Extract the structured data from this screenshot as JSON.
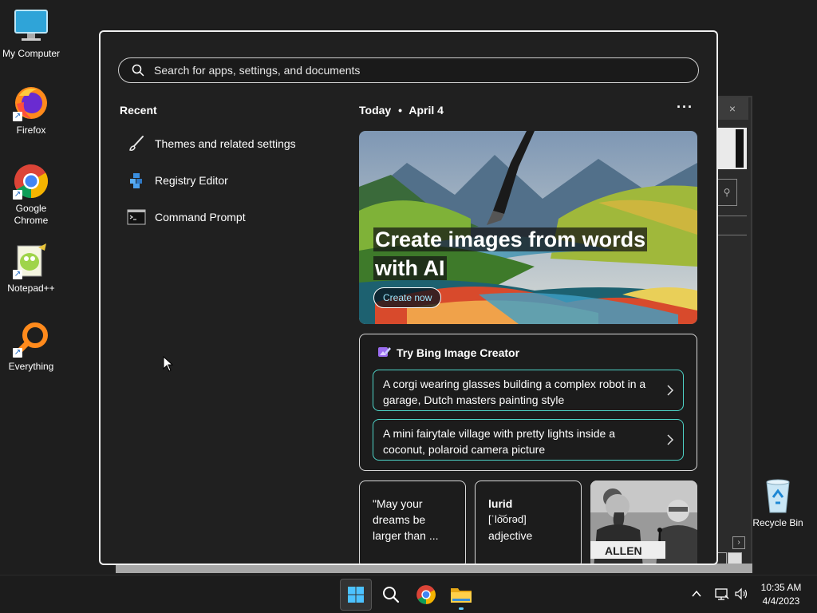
{
  "desktop": {
    "icons": [
      {
        "label": "My Computer",
        "icon": "computer-icon"
      },
      {
        "label": "Firefox",
        "icon": "firefox-icon"
      },
      {
        "label": "Google Chrome",
        "icon": "chrome-icon"
      },
      {
        "label": "Notepad++",
        "icon": "notepadpp-icon"
      },
      {
        "label": "Everything",
        "icon": "everything-icon"
      },
      {
        "label": "Recycle Bin",
        "icon": "recycle-bin-icon"
      }
    ]
  },
  "background_window": {
    "close_glyph": "×",
    "scroll_glyph": "›"
  },
  "start_menu": {
    "search": {
      "placeholder": "Search for apps, settings, and documents",
      "value": ""
    },
    "recent": {
      "heading": "Recent",
      "items": [
        {
          "label": "Themes and related settings",
          "icon": "paintbrush-icon"
        },
        {
          "label": "Registry Editor",
          "icon": "registry-icon"
        },
        {
          "label": "Command Prompt",
          "icon": "terminal-icon"
        }
      ]
    },
    "today": {
      "label": "Today",
      "separator": "•",
      "date": "April 4",
      "more": "···"
    },
    "hero": {
      "title_line1": "Create images from words",
      "title_line2": "with AI",
      "button": "Create now"
    },
    "bing": {
      "title": "Try Bing Image Creator",
      "prompts": [
        {
          "line1": "A corgi wearing glasses building a complex robot in a",
          "line2": "garage, Dutch masters painting style"
        },
        {
          "line1": "A mini fairytale village with pretty lights inside a",
          "line2": "coconut, polaroid camera picture"
        }
      ]
    },
    "cards": {
      "quote": {
        "line1": "\"May your",
        "line2": "dreams be",
        "line3": "larger than ..."
      },
      "word": {
        "title": "lurid",
        "pronunciation": "[ˈlo͝orəd]",
        "pos": "adjective"
      },
      "photo": {
        "caption": "ALLEN"
      }
    }
  },
  "taskbar": {
    "apps": [
      "start-icon",
      "search-icon",
      "chrome-icon",
      "file-explorer-icon"
    ],
    "clock": {
      "time": "10:35 AM",
      "date": "4/4/2023"
    }
  },
  "colors": {
    "accent": "#60cdff",
    "prompt_border": "#4ed4c8",
    "menu_bg": "#202020"
  }
}
